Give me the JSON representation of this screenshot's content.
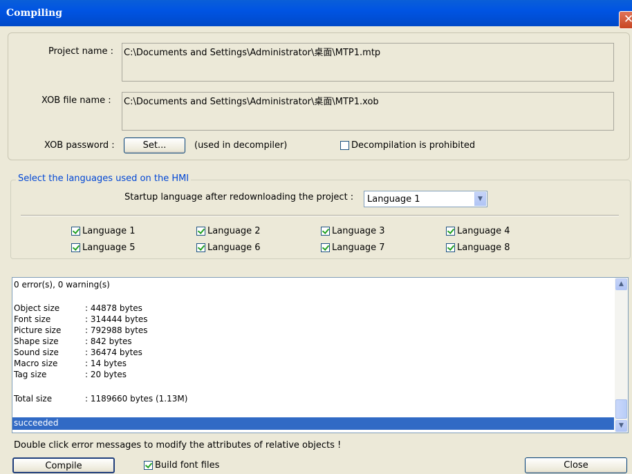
{
  "window": {
    "title": "Compiling",
    "close_glyph": "✕"
  },
  "project": {
    "project_name_label": "Project name :",
    "project_name_value": "C:\\Documents and Settings\\Administrator\\桌面\\MTP1.mtp",
    "xob_file_label": "XOB file name :",
    "xob_file_value": "C:\\Documents and Settings\\Administrator\\桌面\\MTP1.xob",
    "xob_password_label": "XOB password :",
    "set_button": "Set...",
    "used_note": "(used in decompiler)",
    "decompile_label": "Decompilation is prohibited",
    "decompile_checked": false
  },
  "languages": {
    "group_title": "Select the languages used on the HMI",
    "startup_label": "Startup language after redownloading the project :",
    "startup_value": "Language 1",
    "items": [
      {
        "label": "Language 1",
        "checked": true
      },
      {
        "label": "Language 2",
        "checked": true
      },
      {
        "label": "Language 3",
        "checked": true
      },
      {
        "label": "Language 4",
        "checked": true
      },
      {
        "label": "Language 5",
        "checked": true
      },
      {
        "label": "Language 6",
        "checked": true
      },
      {
        "label": "Language 7",
        "checked": true
      },
      {
        "label": "Language 8",
        "checked": true
      }
    ]
  },
  "log": {
    "summary": "0 error(s), 0 warning(s)",
    "rows": [
      {
        "k": "Object size",
        "v": ": 44878 bytes"
      },
      {
        "k": "Font size",
        "v": ": 314444 bytes"
      },
      {
        "k": "Picture size",
        "v": ": 792988 bytes"
      },
      {
        "k": "Shape size",
        "v": ": 842 bytes"
      },
      {
        "k": "Sound size",
        "v": ": 36474 bytes"
      },
      {
        "k": "Macro size",
        "v": ": 14 bytes"
      },
      {
        "k": "Tag size",
        "v": ": 20 bytes"
      }
    ],
    "total_k": "Total size",
    "total_v": ": 1189660 bytes (1.13M)",
    "result": "succeeded"
  },
  "footer": {
    "hint": "Double click error messages to modify the attributes of relative objects !",
    "compile_button": "Compile",
    "build_fonts_label": "Build font files",
    "build_fonts_checked": true,
    "close_button": "Close"
  },
  "colors": {
    "titlebar": "#0054e3",
    "selection": "#316ac5",
    "group_title": "#0046d5"
  }
}
